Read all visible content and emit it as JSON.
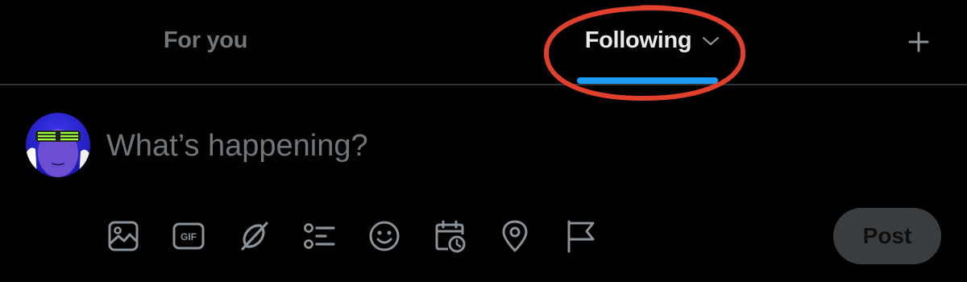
{
  "tabs": {
    "for_you_label": "For you",
    "following_label": "Following"
  },
  "composer": {
    "placeholder": "What’s happening?",
    "toolbar": [
      "media-icon",
      "gif-icon",
      "grok-icon",
      "poll-icon",
      "emoji-icon",
      "schedule-icon",
      "location-icon",
      "flag-icon"
    ],
    "gif_text": "GIF",
    "post_label": "Post"
  },
  "colors": {
    "background": "#000000",
    "active_tab_text": "#e7e9ea",
    "inactive_tab_text": "#71767b",
    "tab_indicator": "#1d9bf0",
    "annotation_ring": "#e0402c",
    "icon": "#8b9298",
    "post_button_bg": "#3a3d40"
  }
}
